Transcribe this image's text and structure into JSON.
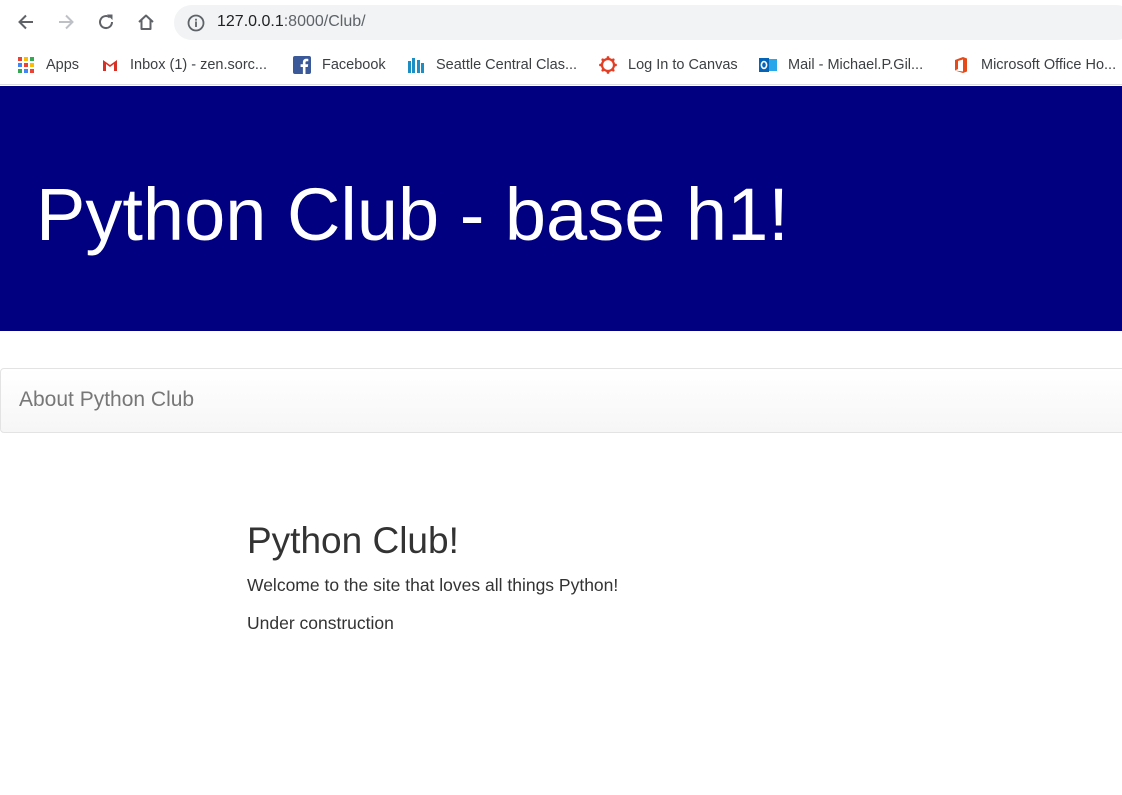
{
  "browser": {
    "url_host": "127.0.0.1",
    "url_rest": ":8000/Club/",
    "icons": [
      "back-arrow-icon",
      "forward-arrow-icon",
      "reload-icon",
      "home-icon",
      "info-icon"
    ]
  },
  "bookmarks": [
    {
      "label": "Apps",
      "icon": "apps-grid-icon"
    },
    {
      "label": "Inbox (1) - zen.sorc...",
      "icon": "gmail-icon"
    },
    {
      "label": "Facebook",
      "icon": "facebook-icon"
    },
    {
      "label": "Seattle Central Clas...",
      "icon": "seattle-central-icon"
    },
    {
      "label": "Log In to Canvas",
      "icon": "canvas-icon"
    },
    {
      "label": "Mail - Michael.P.Gil...",
      "icon": "outlook-icon"
    },
    {
      "label": "Microsoft Office Ho...",
      "icon": "office-icon"
    }
  ],
  "page": {
    "banner_title": "Python Club - base h1!",
    "banner_color": "#000080",
    "nav_link": "About Python Club",
    "heading": "Python Club!",
    "welcome": "Welcome to the site that loves all things Python!",
    "status": "Under construction"
  }
}
